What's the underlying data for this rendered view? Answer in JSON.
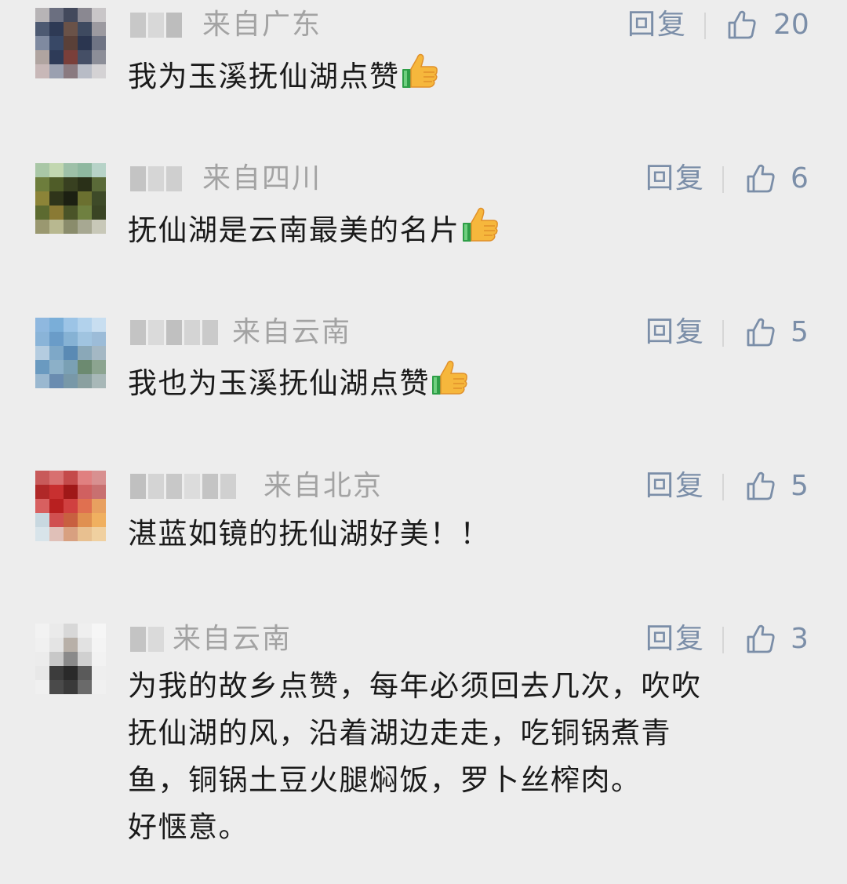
{
  "comments": [
    {
      "region": "来自广东",
      "reply_label": "回复",
      "like_icon": "thumbs-up-outline-icon",
      "likes": "20",
      "text": "我为玉溪抚仙湖点赞",
      "trailing_emoji": "thumbs-up-emoji"
    },
    {
      "region": "来自四川",
      "reply_label": "回复",
      "like_icon": "thumbs-up-outline-icon",
      "likes": "6",
      "text": "抚仙湖是云南最美的名片",
      "trailing_emoji": "thumbs-up-emoji"
    },
    {
      "region": "来自云南",
      "reply_label": "回复",
      "like_icon": "thumbs-up-outline-icon",
      "likes": "5",
      "text": "我也为玉溪抚仙湖点赞",
      "trailing_emoji": "thumbs-up-emoji"
    },
    {
      "region": "来自北京",
      "reply_label": "回复",
      "like_icon": "thumbs-up-outline-icon",
      "likes": "5",
      "text": "湛蓝如镜的抚仙湖好美！！"
    },
    {
      "region": "来自云南",
      "reply_label": "回复",
      "like_icon": "thumbs-up-outline-icon",
      "likes": "3",
      "text_lines": [
        "为我的故乡点赞，每年必须回去几次，吹吹",
        "抚仙湖的风，沿着湖边走走，吃铜锅煮青",
        "鱼，铜锅土豆火腿焖饭，罗卜丝榨肉。",
        "好惬意。"
      ]
    }
  ],
  "colors": {
    "background": "#ededed",
    "meta_gray": "#a3a3a3",
    "action_blue_gray": "#7b8ea8",
    "text": "#1a1a1a"
  }
}
